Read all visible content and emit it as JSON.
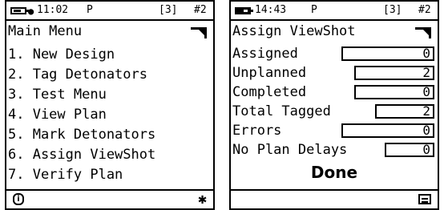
{
  "left_screen": {
    "status": {
      "time": "11:02",
      "mode": "P",
      "signal": "[3]",
      "channel": "#2"
    },
    "title": "Main Menu",
    "menu_items": [
      "1. New Design",
      "2. Tag Detonators",
      "3. Test Menu",
      "4. View Plan",
      "5. Mark Detonators",
      "6. Assign ViewShot",
      "7. Verify Plan"
    ],
    "icons": {
      "status_left": "battery-plug-icon",
      "title_right": "folded-corner-icon",
      "bottom_left": "info-icon",
      "bottom_right": "gear-icon"
    }
  },
  "right_screen": {
    "status": {
      "time": "14:43",
      "mode": "P",
      "signal": "[3]",
      "channel": "#2"
    },
    "title": "Assign ViewShot",
    "fields": [
      {
        "label": "Assigned",
        "value": "0"
      },
      {
        "label": "Unplanned",
        "value": "2"
      },
      {
        "label": "Completed",
        "value": "0"
      },
      {
        "label": "Total Tagged",
        "value": "2"
      },
      {
        "label": "Errors",
        "value": "0"
      },
      {
        "label": "No Plan Delays",
        "value": "0"
      }
    ],
    "done_label": "Done",
    "icons": {
      "status_left": "battery-icon",
      "title_right": "folded-corner-icon",
      "bottom_right": "menu-icon"
    }
  }
}
